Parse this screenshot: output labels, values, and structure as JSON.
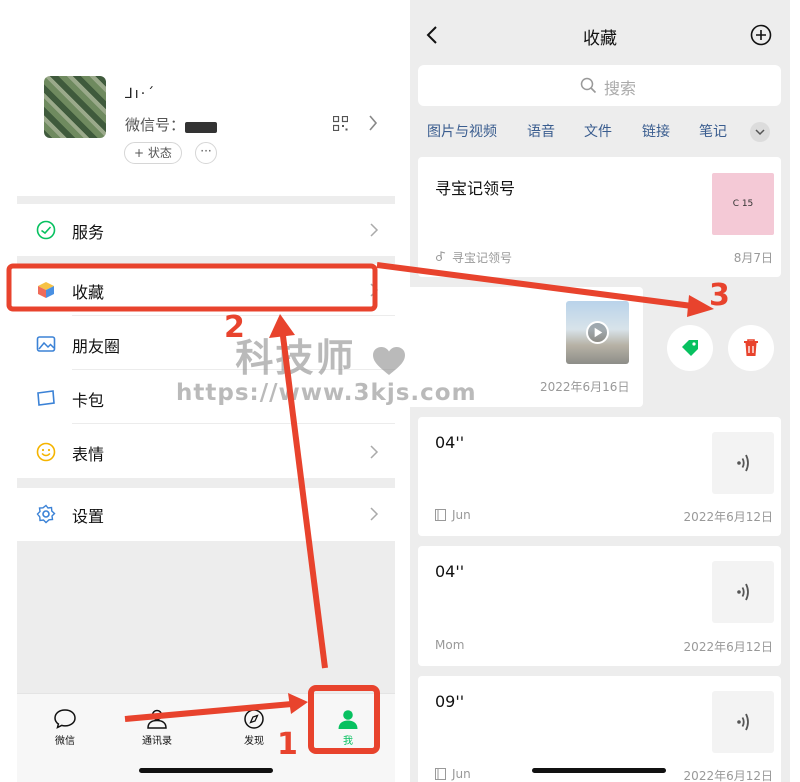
{
  "me_page": {
    "profile": {
      "nickname": "⅃ı·ˊ",
      "wechat_id_label": "微信号：",
      "wechat_id_value": "         ,",
      "status_label": "+ 状态",
      "more_label": "···"
    },
    "menu": [
      {
        "label": "服务",
        "icon": "service-icon"
      },
      {
        "label": "收藏",
        "icon": "favorites-cube-icon"
      },
      {
        "label": "朋友圈",
        "icon": "moments-picture-icon"
      },
      {
        "label": "卡包",
        "icon": "card-wallet-icon"
      },
      {
        "label": "表情",
        "icon": "sticker-smile-icon"
      },
      {
        "label": "设置",
        "icon": "settings-gear-icon"
      }
    ],
    "tabbar": [
      {
        "label": "微信",
        "icon": "chat-bubble-icon"
      },
      {
        "label": "通讯录",
        "icon": "contacts-icon"
      },
      {
        "label": "发现",
        "icon": "compass-icon"
      },
      {
        "label": "我",
        "icon": "person-icon",
        "active": true
      }
    ]
  },
  "favorites_page": {
    "title": "收藏",
    "search_placeholder": "搜索",
    "filters": [
      "图片与视频",
      "语音",
      "文件",
      "链接",
      "笔记"
    ],
    "items": [
      {
        "type": "article",
        "title": "寻宝记领号",
        "source": "寻宝记领号",
        "date": "8月7日",
        "thumb_text": "C 15"
      },
      {
        "type": "video",
        "date": "2022年6月16日"
      },
      {
        "type": "voice",
        "duration": "04''",
        "source": "Jun",
        "date": "2022年6月12日"
      },
      {
        "type": "voice",
        "duration": "04''",
        "source": "Mom",
        "date": "2022年6月12日"
      },
      {
        "type": "voice",
        "duration": "09''",
        "source": "Jun",
        "date": "2022年6月12日"
      }
    ],
    "swipe_actions": [
      "tag-icon",
      "delete-icon"
    ]
  },
  "annotations": {
    "steps": [
      "1",
      "2",
      "3"
    ],
    "color": "#e8432d"
  },
  "watermark": {
    "title": "科技师",
    "url": "https://www.3kjs.com"
  }
}
